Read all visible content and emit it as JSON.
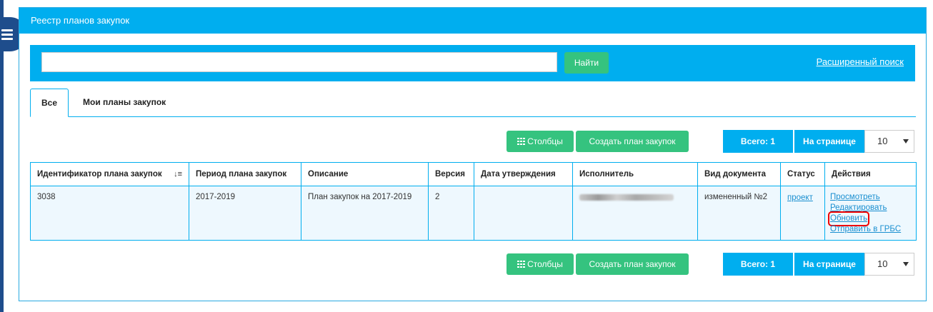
{
  "panel": {
    "title": "Реестр планов закупок"
  },
  "search": {
    "placeholder": "",
    "value": "",
    "find_label": "Найти",
    "advanced_label": "Расширенный поиск"
  },
  "tabs": [
    {
      "label": "Все",
      "active": true
    },
    {
      "label": "Мои планы закупок",
      "active": false
    }
  ],
  "toolbar": {
    "columns_label": "Столбцы",
    "columns_icon": "grid-icon",
    "create_label": "Создать план закупок",
    "total_label": "Всего: 1",
    "per_page_label": "На странице",
    "per_page_value": "10"
  },
  "table": {
    "headers": [
      "Идентификатор плана закупок",
      "Период плана закупок",
      "Описание",
      "Версия",
      "Дата утверждения",
      "Исполнитель",
      "Вид документа",
      "Статус",
      "Действия"
    ],
    "sort_icon": "sort-icon",
    "rows": [
      {
        "id": "3038",
        "period": "2017-2019",
        "description": "План закупок на 2017-2019",
        "version": "2",
        "approval_date": "",
        "executor": "",
        "doc_type": "измененный №2",
        "status": "проект",
        "actions": [
          "Просмотреть",
          "Редактировать",
          "Обновить",
          "Отправить в ГРБС"
        ]
      }
    ]
  },
  "colors": {
    "accent": "#00aeef",
    "green": "#35c37f",
    "sidebar": "#1e4d8c",
    "highlight": "#e00000"
  }
}
